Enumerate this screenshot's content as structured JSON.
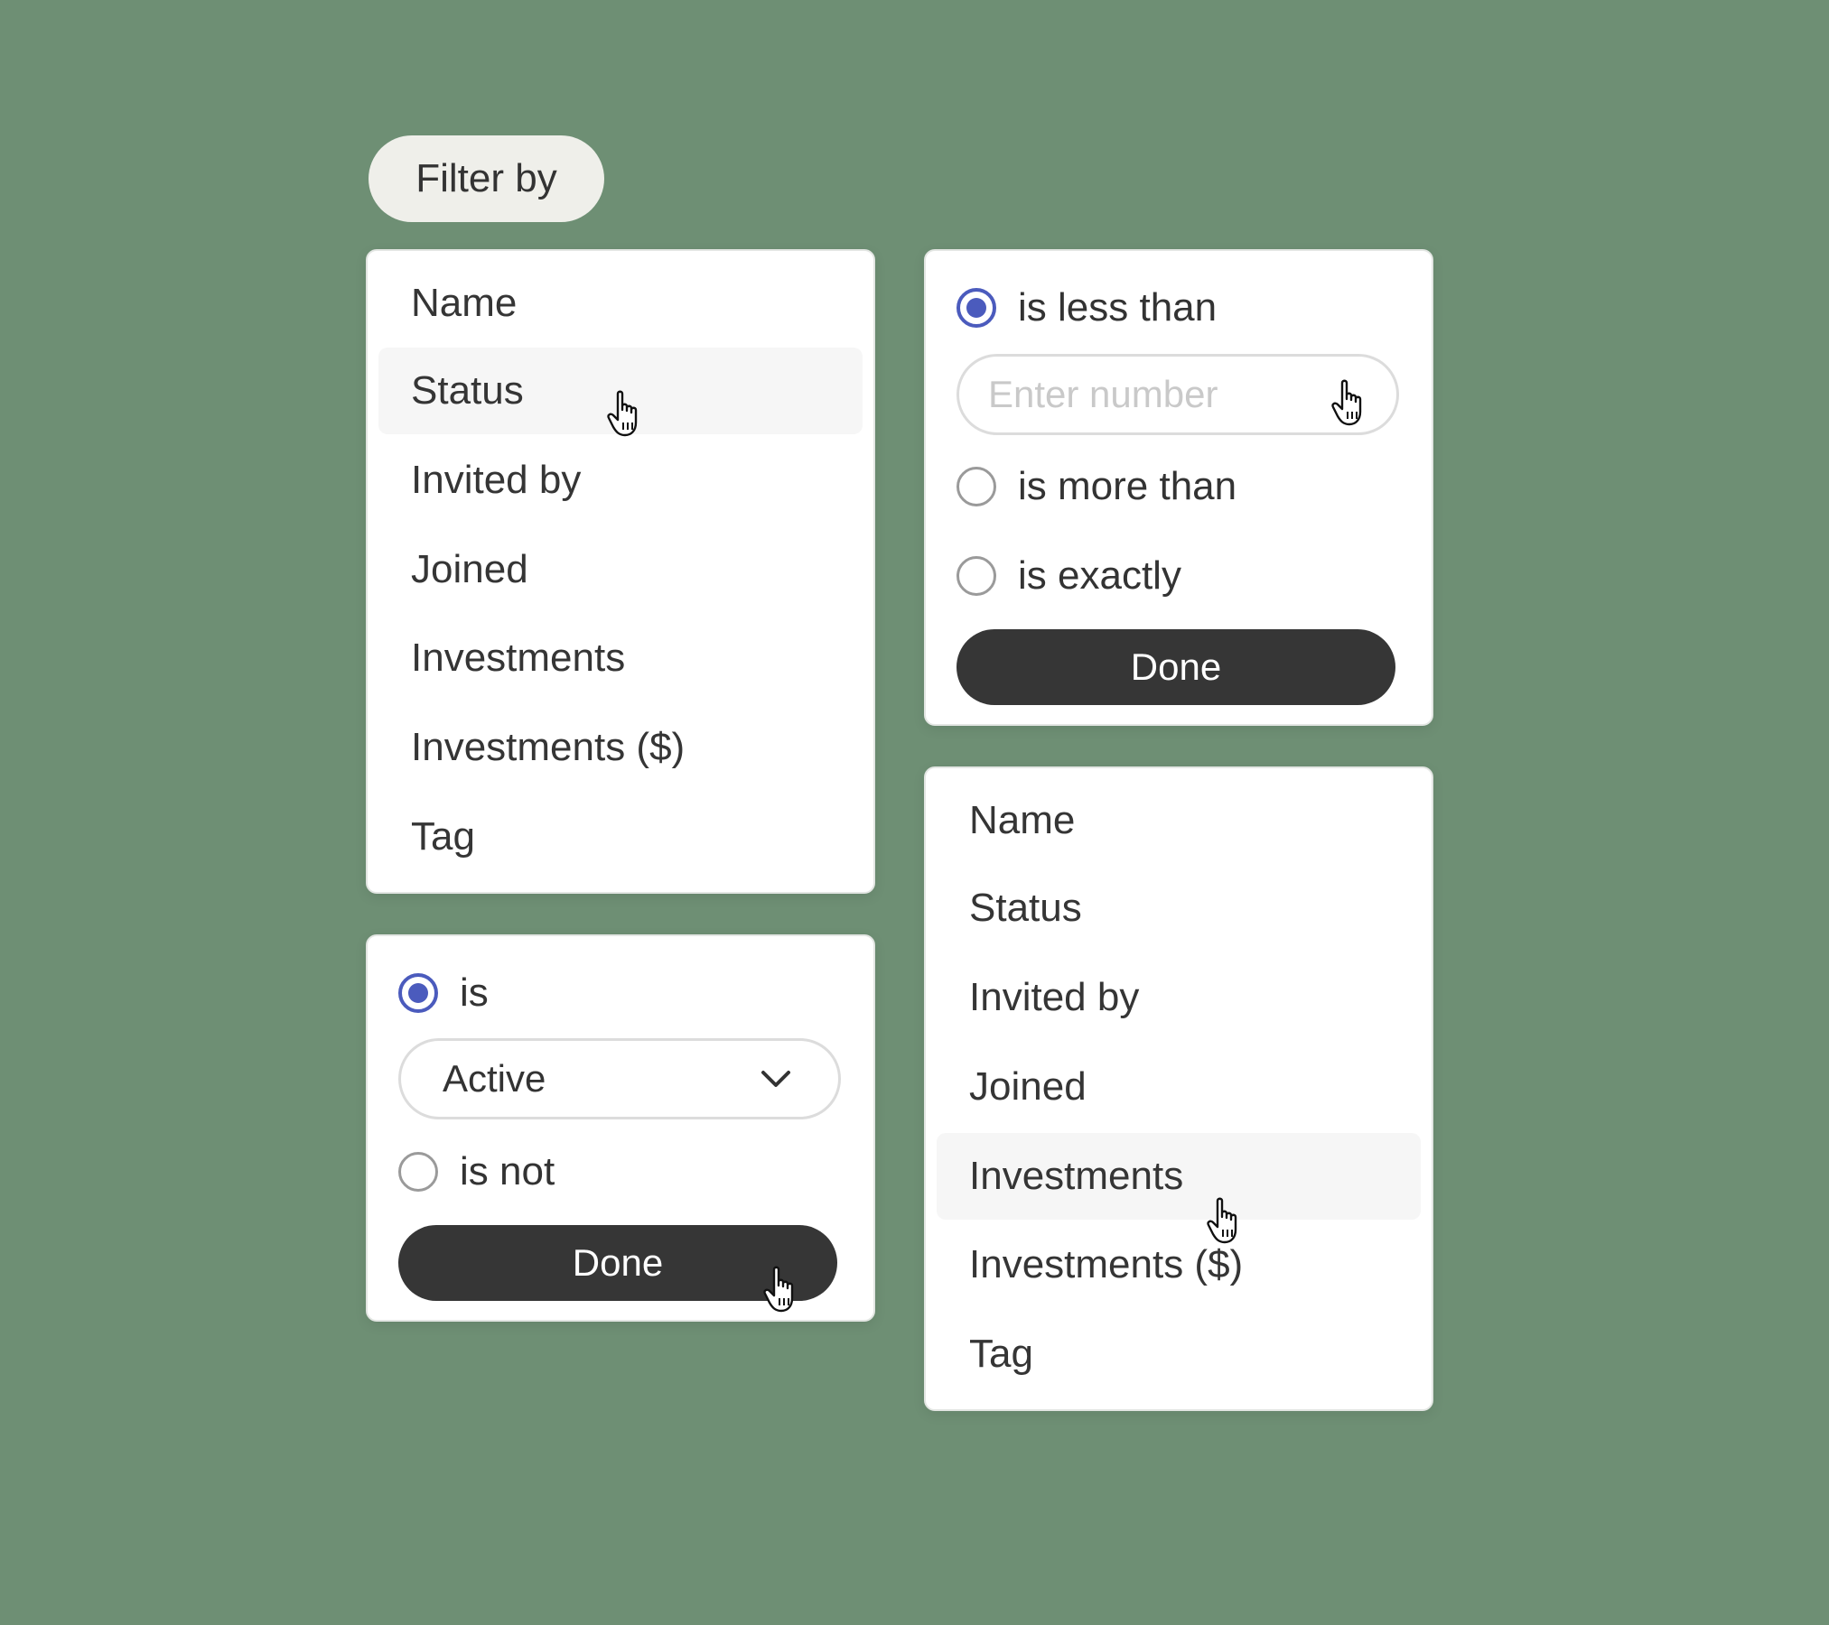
{
  "filter_button": {
    "label": "Filter by"
  },
  "field_menu_primary": {
    "items": [
      "Name",
      "Status",
      "Invited by",
      "Joined",
      "Investments",
      "Investments ($)",
      "Tag"
    ],
    "hovered_item": "Status"
  },
  "number_filter": {
    "options": [
      {
        "label": "is less than",
        "checked": true
      },
      {
        "label": "is more than",
        "checked": false
      },
      {
        "label": "is exactly",
        "checked": false
      }
    ],
    "input_placeholder": "Enter number",
    "done_label": "Done"
  },
  "status_filter": {
    "options": [
      {
        "label": "is",
        "checked": true
      },
      {
        "label": "is not",
        "checked": false
      }
    ],
    "selected_value": "Active",
    "done_label": "Done"
  },
  "field_menu_secondary": {
    "items": [
      "Name",
      "Status",
      "Invited by",
      "Joined",
      "Investments",
      "Investments ($)",
      "Tag"
    ],
    "hovered_item": "Investments"
  },
  "colors": {
    "background": "#6e8f74",
    "card": "#ffffff",
    "radio_accent": "#4b5bbd",
    "button_dark": "#363636",
    "pill": "#efefea"
  },
  "icons": {
    "cursor": "hand-pointer-icon",
    "dropdown": "chevron-down-icon"
  }
}
